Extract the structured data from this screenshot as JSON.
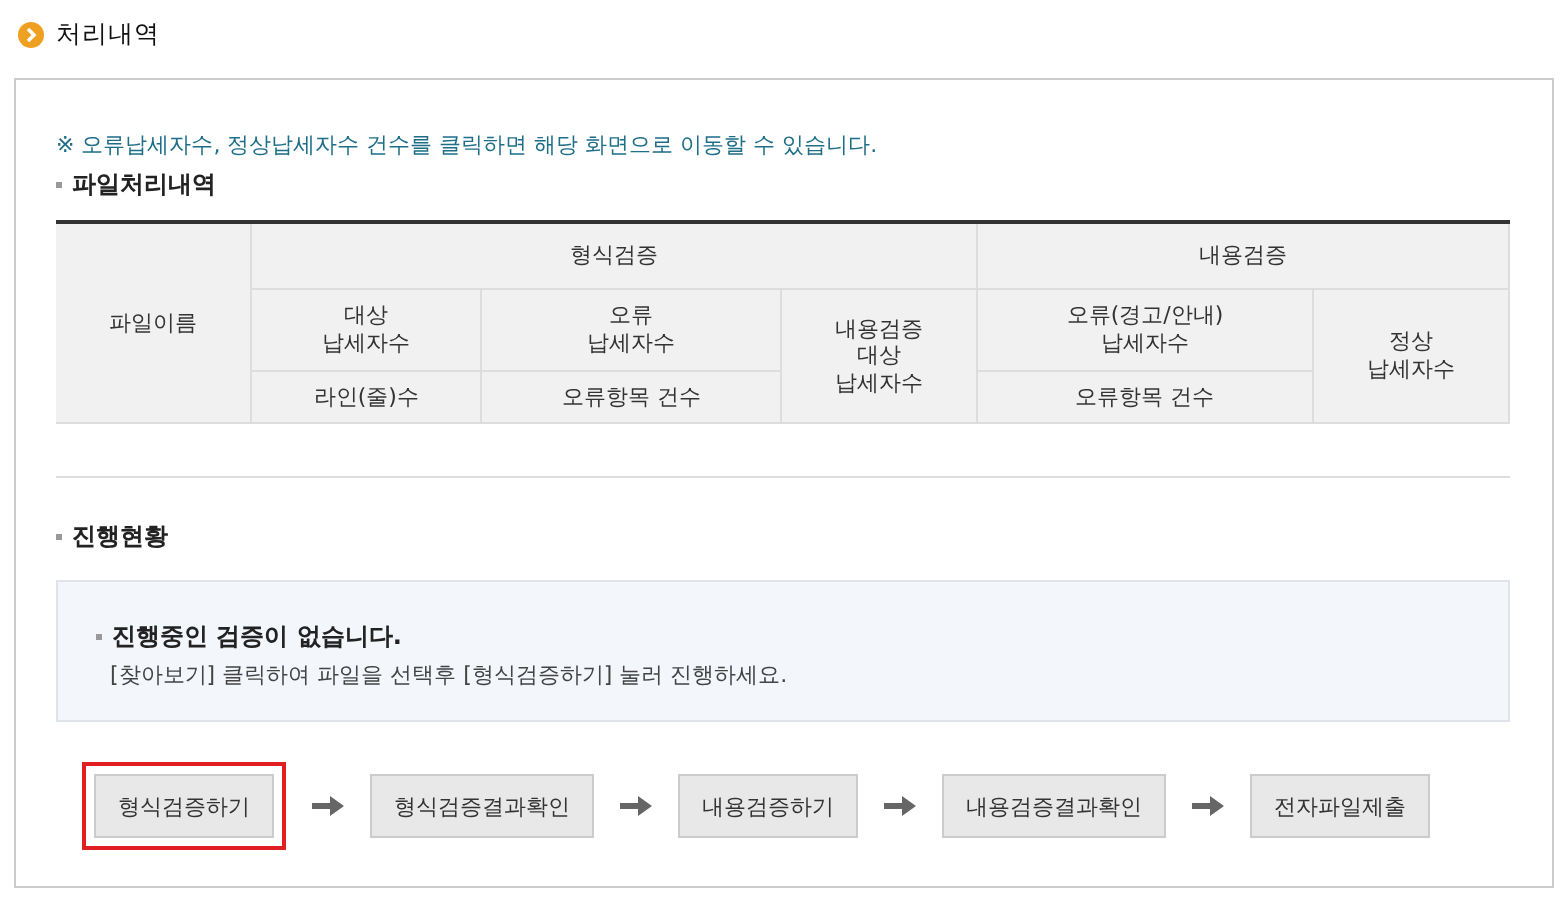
{
  "title": "처리내역",
  "notice": "※ 오류납세자수, 정상납세자수 건수를 클릭하면 해당 화면으로 이동할 수 있습니다.",
  "file_section": {
    "heading": "파일처리내역",
    "header_rows": [
      [
        {
          "text": "파일이름",
          "rowspan": 3
        },
        {
          "text": "형식검증",
          "colspan": 3
        },
        {
          "text": "내용검증",
          "colspan": 2
        }
      ],
      [
        {
          "text": "대상\n납세자수"
        },
        {
          "text": "오류\n납세자수"
        },
        {
          "text": "내용검증\n대상\n납세자수",
          "rowspan": 2
        },
        {
          "text": "오류(경고/안내)\n납세자수"
        },
        {
          "text": "정상\n납세자수",
          "rowspan": 2
        }
      ],
      [
        {
          "text": "라인(줄)수"
        },
        {
          "text": "오류항목 건수"
        },
        {
          "text": "오류항목 건수"
        }
      ]
    ]
  },
  "progress_section": {
    "heading": "진행현황",
    "status_title": "진행중인 검증이 없습니다.",
    "status_text": "[찾아보기] 클릭하여 파일을 선택후 [형식검증하기] 눌러 진행하세요."
  },
  "steps": [
    {
      "label": "형식검증하기",
      "highlighted": true
    },
    {
      "label": "형식검증결과확인",
      "highlighted": false
    },
    {
      "label": "내용검증하기",
      "highlighted": false
    },
    {
      "label": "내용검증결과확인",
      "highlighted": false
    },
    {
      "label": "전자파일제출",
      "highlighted": false
    }
  ]
}
